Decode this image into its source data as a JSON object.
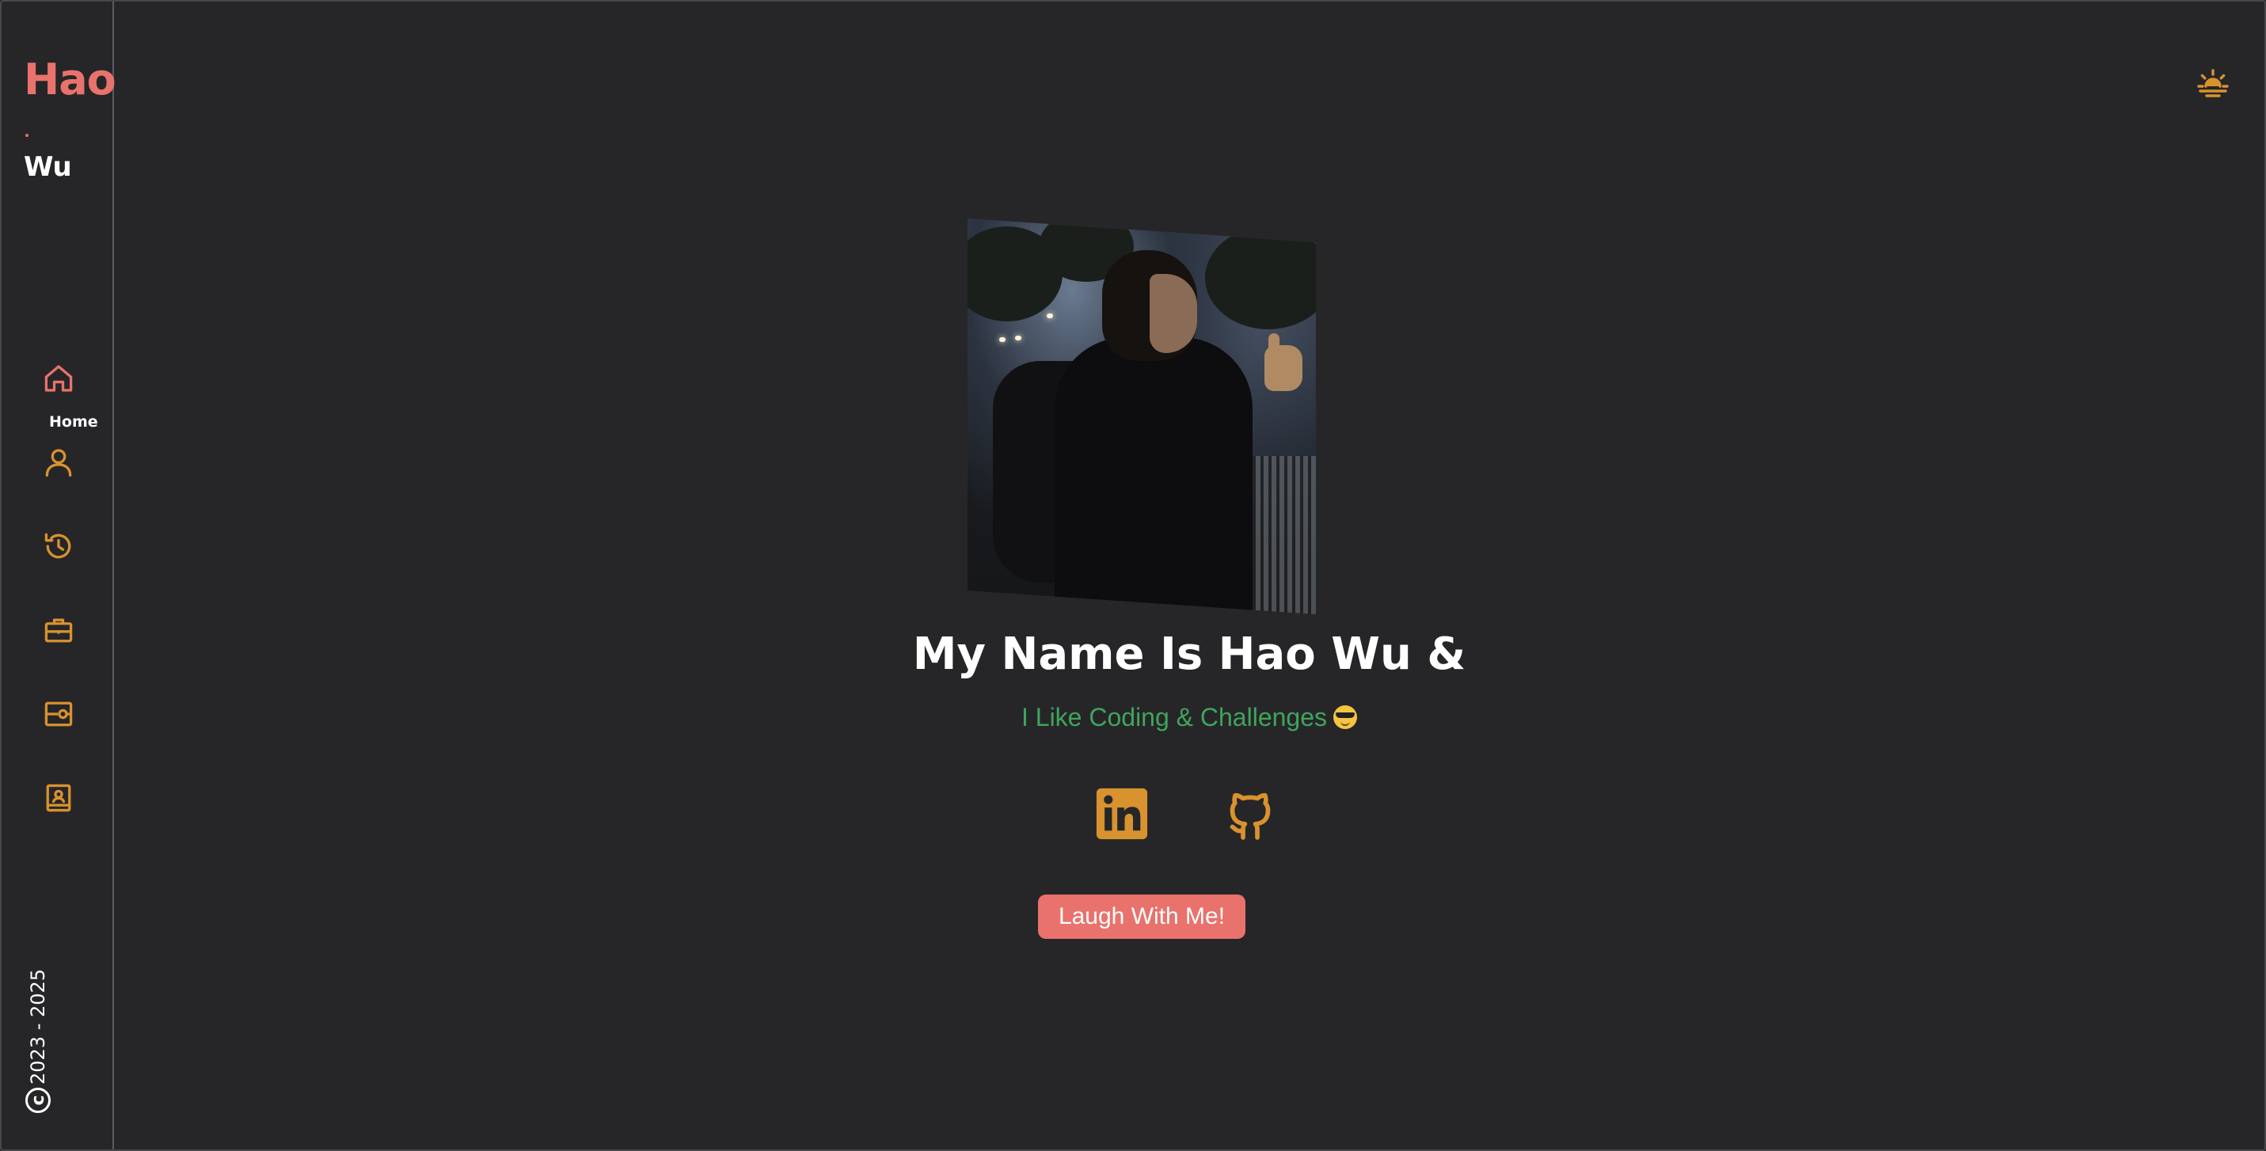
{
  "brand": {
    "first_name": "Hao",
    "last_name": "Wu"
  },
  "sidebar": {
    "items": [
      {
        "label": "Home",
        "icon": "home-icon",
        "active": true
      },
      {
        "icon": "user-icon"
      },
      {
        "icon": "history-icon"
      },
      {
        "icon": "briefcase-icon"
      },
      {
        "icon": "project-icon"
      },
      {
        "icon": "contact-icon"
      }
    ],
    "copyright": "2023 - 2025"
  },
  "hero": {
    "headline": "My Name Is Hao Wu &",
    "tagline": "I Like Coding & Challenges",
    "socials": [
      {
        "icon": "linkedin-icon"
      },
      {
        "icon": "github-icon"
      }
    ],
    "cta_label": "Laugh With Me!"
  },
  "theme_toggle": {
    "icon": "sun-theme-icon"
  },
  "colors": {
    "background": "#262629",
    "accent": "#e9726c",
    "icon": "#d8922e",
    "tagline": "#3fa55b",
    "text": "#ffffff"
  }
}
